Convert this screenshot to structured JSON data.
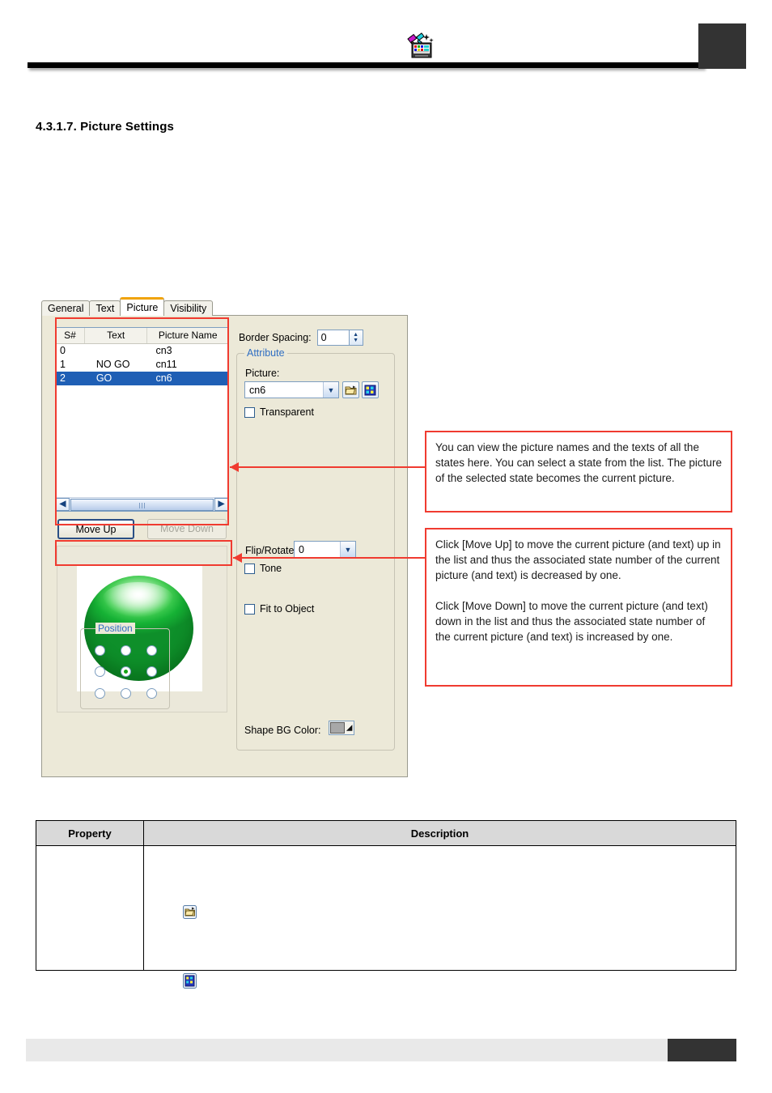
{
  "header": {
    "logo_icon": "picture-library-icon"
  },
  "section": {
    "number": "4.3.1.7.",
    "title": "Picture Settings",
    "heading": "4.3.1.7.  Picture Settings"
  },
  "dialog": {
    "tabs": [
      {
        "label": "General",
        "active": false
      },
      {
        "label": "Text",
        "active": false
      },
      {
        "label": "Picture",
        "active": true
      },
      {
        "label": "Visibility",
        "active": false
      }
    ],
    "state_list": {
      "columns": [
        "S#",
        "Text",
        "Picture Name"
      ],
      "rows": [
        {
          "state": "0",
          "text": "",
          "picture": "cn3",
          "selected": false
        },
        {
          "state": "1",
          "text": "NO GO",
          "picture": "cn11",
          "selected": false
        },
        {
          "state": "2",
          "text": "GO",
          "picture": "cn6",
          "selected": true
        }
      ],
      "scroll_left_icon": "chevron-left-icon",
      "scroll_right_icon": "chevron-right-icon"
    },
    "buttons": {
      "move_up": "Move Up",
      "move_down": "Move Down",
      "move_down_disabled": true
    },
    "preview": {
      "alt": "green-round-button-picture"
    },
    "border_spacing": {
      "label": "Border Spacing:",
      "value": "0"
    },
    "attribute": {
      "legend": "Attribute",
      "picture_label": "Picture:",
      "picture_value": "cn6",
      "browse_icon": "open-folder-icon",
      "library_icon": "picture-library-grid-icon",
      "transparent_label": "Transparent",
      "transparent_checked": false,
      "flip_rotate_label": "Flip/Rotate:",
      "flip_rotate_value": "0",
      "tone_label": "Tone",
      "tone_checked": false,
      "fit_to_object_label": "Fit to Object",
      "fit_to_object_checked": false,
      "position": {
        "legend": "Position",
        "selected_index": 4,
        "cells": 9
      },
      "shape_bg_label": "Shape BG Color:",
      "shape_bg_color": "#a8a8a8"
    }
  },
  "callouts": {
    "list": "You can view the picture names and the texts of all the states here. You can select a state from the list. The picture of the selected state becomes the current picture.",
    "move_up": "Click [Move Up] to move the current picture (and text) up in the list and thus the associated state number of the current picture (and text) is decreased by one.",
    "move_down": "Click [Move Down] to move the current picture (and text) down in the list and thus the associated state number of the current picture (and text) is increased by one."
  },
  "property_table": {
    "headers": [
      "Property",
      "Description"
    ],
    "rows": [
      {
        "property": "",
        "description": "",
        "icons": [
          "open-folder-icon",
          "picture-library-grid-icon"
        ]
      }
    ]
  },
  "colors": {
    "annotation_red": "#f03b30",
    "dialog_bg": "#ece9d8",
    "selection_blue": "#1f5fb5",
    "group_legend_blue": "#2f6ec2",
    "active_tab_accent": "#f0a30a"
  }
}
